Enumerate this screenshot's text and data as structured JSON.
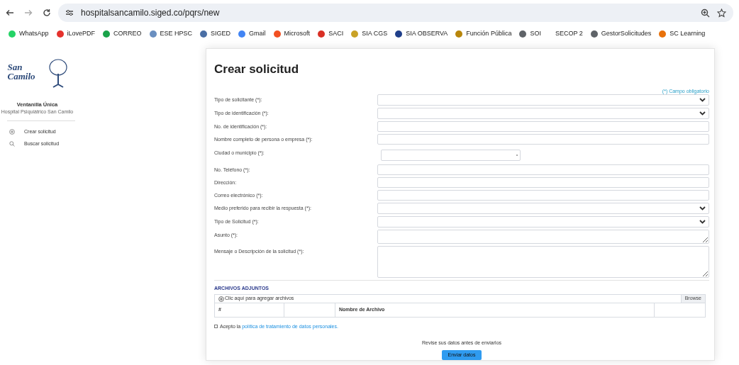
{
  "browser": {
    "url": "hospitalsancamilo.siged.co/pqrs/new",
    "bookmarks": [
      {
        "label": "WhatsApp",
        "color": "#25d366"
      },
      {
        "label": "iLovePDF",
        "color": "#e5322d"
      },
      {
        "label": "CORREO",
        "color": "#1aa34a"
      },
      {
        "label": "ESE HPSC",
        "color": "#6a8fc0"
      },
      {
        "label": "SIGED",
        "color": "#4a6fa5"
      },
      {
        "label": "Gmail",
        "color": "#4285f4"
      },
      {
        "label": "Microsoft",
        "color": "#f25022"
      },
      {
        "label": "SACI",
        "color": "#d93025"
      },
      {
        "label": "SIA CGS",
        "color": "#c9a227"
      },
      {
        "label": "SIA OBSERVA",
        "color": "#1f3f8a"
      },
      {
        "label": "Función Pública",
        "color": "#b8860b"
      },
      {
        "label": "SOI",
        "color": "#5f6368"
      },
      {
        "label": "SECOP 2"
      },
      {
        "label": "GestorSolicitudes",
        "color": "#5f6368"
      },
      {
        "label": "SC Learning",
        "color": "#e8710a"
      }
    ]
  },
  "sidebar": {
    "logo_text": "San Camilo",
    "title": "Ventanilla Única",
    "subtitle": "Hospital Psiquiátrico San Camilo",
    "items": [
      {
        "label": "Crear solicitud"
      },
      {
        "label": "Buscar solicitud"
      }
    ]
  },
  "form": {
    "title": "Crear solicitud",
    "required_note": "(*) Campo obligatorio",
    "fields": [
      {
        "label": "Tipo de solicitante (*):",
        "kind": "select"
      },
      {
        "label": "Tipo de identificación (*):",
        "kind": "select"
      },
      {
        "label": "No. de identificación (*):",
        "kind": "text"
      },
      {
        "label": "Nombre completo de persona o empresa (*):",
        "kind": "text"
      },
      {
        "label": "Ciudad o municipio (*):",
        "kind": "combo"
      },
      {
        "label": "No. Teléfono (*):",
        "kind": "text"
      },
      {
        "label": "Dirección:",
        "kind": "text"
      },
      {
        "label": "Correo electrónico (*):",
        "kind": "text"
      },
      {
        "label": "Medio preferido para recibir la respuesta (*):",
        "kind": "select"
      },
      {
        "label": "Tipo de Solicitud (*):",
        "kind": "select"
      },
      {
        "label": "Asunto (*):",
        "kind": "textarea_small"
      },
      {
        "label": "Mensaje o Descripción de la solicitud (*):",
        "kind": "textarea"
      }
    ],
    "attachments": {
      "heading": "ARCHIVOS ADJUNTOS",
      "add_label": "Clic aquí para agregar archivos",
      "browse": "Browse",
      "columns": [
        "#",
        "",
        "Nombre de Archivo",
        ""
      ]
    },
    "consent": {
      "checked": false,
      "text": "Acepto la",
      "link": "política de tratamiento de datos personales."
    },
    "review_note": "Revise sus datos antes de enviarlos",
    "submit": "Enviar datos"
  }
}
